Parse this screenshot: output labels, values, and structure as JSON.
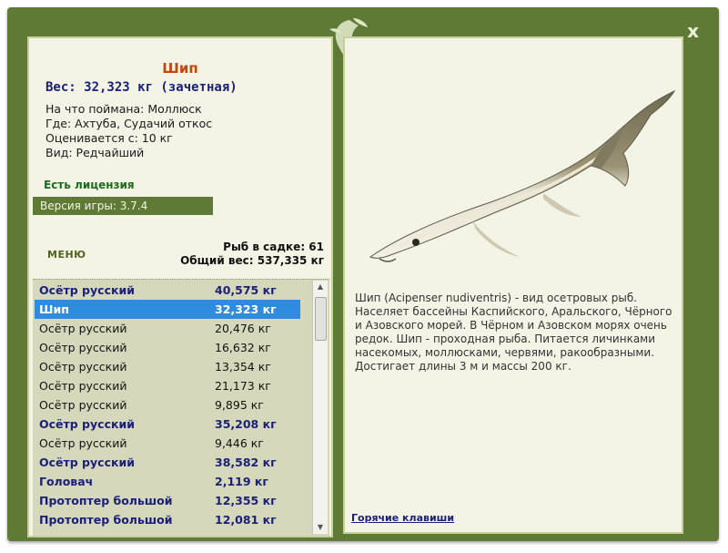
{
  "window": {
    "close_label": "x"
  },
  "catch": {
    "fish_name": "Шип",
    "weight_line": "Вес: 32,323 кг (зачетная)",
    "caught_on": "На что поймана: Моллюск",
    "location": "Где: Ахтуба, Судачий откос",
    "rated_from": "Оценивается с: 10 кг",
    "kind": "Вид: Редчайший"
  },
  "license": "Есть лицензия",
  "version": "Версия игры: 3.7.4",
  "menu_label": "МЕНЮ",
  "stats": {
    "fish_in_keepnet": "Рыб в садке: 61",
    "total_weight": "Общий вес: 537,335 кг"
  },
  "fish_list": [
    {
      "name": "Осётр русский",
      "weight": "40,575 кг",
      "record": true,
      "selected": false
    },
    {
      "name": "Шип",
      "weight": "32,323 кг",
      "record": true,
      "selected": true
    },
    {
      "name": "Осётр русский",
      "weight": "20,476 кг",
      "record": false,
      "selected": false
    },
    {
      "name": "Осётр русский",
      "weight": "16,632 кг",
      "record": false,
      "selected": false
    },
    {
      "name": "Осётр русский",
      "weight": "13,354 кг",
      "record": false,
      "selected": false
    },
    {
      "name": "Осётр русский",
      "weight": "21,173 кг",
      "record": false,
      "selected": false
    },
    {
      "name": "Осётр русский",
      "weight": "9,895 кг",
      "record": false,
      "selected": false
    },
    {
      "name": "Осётр русский",
      "weight": "35,208 кг",
      "record": true,
      "selected": false
    },
    {
      "name": "Осётр русский",
      "weight": "9,446 кг",
      "record": false,
      "selected": false
    },
    {
      "name": "Осётр русский",
      "weight": "38,582 кг",
      "record": true,
      "selected": false
    },
    {
      "name": "Головач",
      "weight": "2,119 кг",
      "record": true,
      "selected": false
    },
    {
      "name": "Протоптер большой",
      "weight": "12,355 кг",
      "record": true,
      "selected": false
    },
    {
      "name": "Протоптер большой",
      "weight": "12,081 кг",
      "record": true,
      "selected": false
    }
  ],
  "description": "Шип (Acipenser nudiventris) - вид осетровых рыб. Населяет бассейны Каспийского, Аральского, Чёрного и Азовского морей. В Чёрном и Азовском морях очень редок. Шип - проходная рыба. Питается личинками насекомых, моллюсками, червями, ракообразными. Достигает длины 3 м и массы 200 кг.",
  "hotkeys_link": "Горячие клавиши",
  "colors": {
    "frame": "#5e7a35",
    "panel": "#f4f4e6",
    "list_bg": "#d6d8bb",
    "selection": "#2e8be0",
    "record_text": "#1a1f78",
    "title": "#c0480f"
  }
}
